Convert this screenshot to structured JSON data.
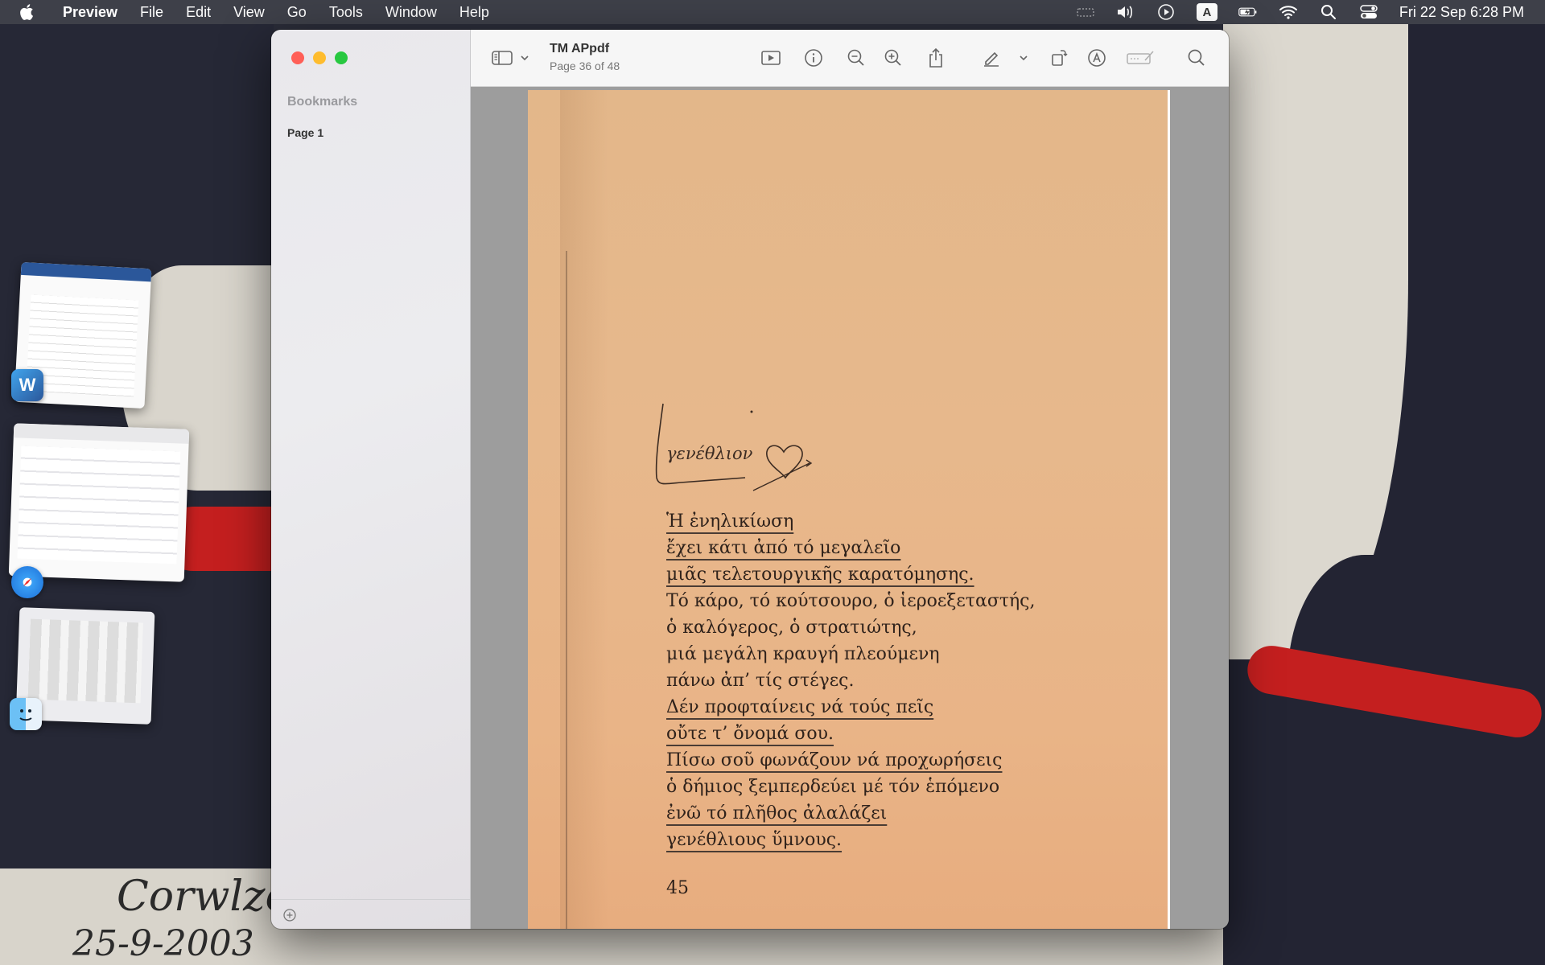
{
  "menubar": {
    "app_name": "Preview",
    "items": [
      "File",
      "Edit",
      "View",
      "Go",
      "Tools",
      "Window",
      "Help"
    ],
    "keyboard_indicator": "A",
    "clock": "Fri 22 Sep  6:28 PM"
  },
  "window": {
    "doc_title": "TM APpdf",
    "page_info": "Page 36 of 48",
    "sidebar": {
      "title": "Bookmarks",
      "bookmarks": [
        "Page 1"
      ]
    }
  },
  "page": {
    "poem_title": "γενέθλιον",
    "lines": [
      "Ἡ ἐνηλικίωση",
      "ἔχει κάτι ἀπό τό μεγαλεῖο",
      "μιᾶς τελετουργικῆς καρατόμησης.",
      "Τό κάρο, τό κούτσουρο, ὁ ἱεροεξεταστής,",
      "ὁ καλόγερος, ὁ στρατιώτης,",
      "μιά μεγάλη κραυγή πλεούμενη",
      "πάνω ἀπ’ τίς στέγες.",
      "Δέν προφταίνεις νά τούς πεῖς",
      "οὔτε τ’ ὄνομά σου.",
      "Πίσω σοῦ φωνάζουν νά προχωρήσεις",
      "ὁ δήμιος ξεμπερδεύει μέ τόν ἑπόμενο",
      "ἐνῶ τό πλῆθος ἀλαλάζει",
      "γενέθλιους ὕμνους."
    ],
    "page_number": "45"
  },
  "wallpaper": {
    "signature": "Corwlzoc",
    "date": "25-9-2003"
  },
  "icons": [
    "apple-icon",
    "volume-icon",
    "play-icon",
    "battery-icon",
    "wifi-icon",
    "search-icon",
    "control-center-icon",
    "sidebar-toggle-icon",
    "slideshow-icon",
    "info-icon",
    "zoom-out-icon",
    "zoom-in-icon",
    "share-icon",
    "highlight-icon",
    "rotate-icon",
    "markup-icon",
    "form-icon",
    "search-icon"
  ]
}
